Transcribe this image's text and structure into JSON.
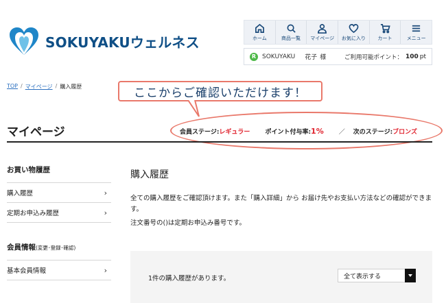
{
  "header": {
    "logo_text": "SOKUYAKUウェルネス",
    "nav": [
      {
        "label": "ホーム",
        "icon": "home-icon"
      },
      {
        "label": "商品一覧",
        "icon": "search-icon"
      },
      {
        "label": "マイページ",
        "icon": "user-icon"
      },
      {
        "label": "お気に入り",
        "icon": "heart-icon"
      },
      {
        "label": "カート",
        "icon": "cart-icon"
      },
      {
        "label": "メニュー",
        "icon": "menu-icon"
      }
    ],
    "user": {
      "badge": "R",
      "brand": "SOKUYAKU",
      "name": "花子",
      "honorific": "様",
      "points_label": "ご利用可能ポイント：",
      "points_value": "100",
      "points_unit": "pt"
    }
  },
  "breadcrumb": {
    "items": [
      "TOP",
      "マイページ",
      "購入履歴"
    ],
    "separator": "/"
  },
  "callout": {
    "text": "ここからご確認いただけます！"
  },
  "page": {
    "title": "マイページ",
    "stage_label": "会員ステージ:",
    "stage_value": "レギュラー",
    "rate_label": "ポイント付与率:",
    "rate_value": "1%",
    "slash": "／",
    "next_label": "次のステージ:",
    "next_value": "ブロンズ"
  },
  "sidebar": {
    "section1_title": "お買い物履歴",
    "section1_items": [
      "購入履歴",
      "定期お申込み履歴"
    ],
    "section2_title": "会員情報",
    "section2_sub": "(変更･登録･確認)",
    "section2_items": [
      "基本会員情報"
    ],
    "chevron": "›"
  },
  "main": {
    "title": "購入履歴",
    "description": "全ての購入履歴をご確認頂けます。また「購入詳細」から お届け先やお支払い方法などの確認ができます。",
    "note": "注文番号の()は定期お申込み番号です。",
    "count_text": "1件の購入履歴があります。",
    "filter_value": "全て表示する"
  },
  "colors": {
    "brand": "#0f4f86",
    "accent_red": "#e0232e",
    "callout_border": "#e9786a",
    "badge_green": "#4db848"
  }
}
